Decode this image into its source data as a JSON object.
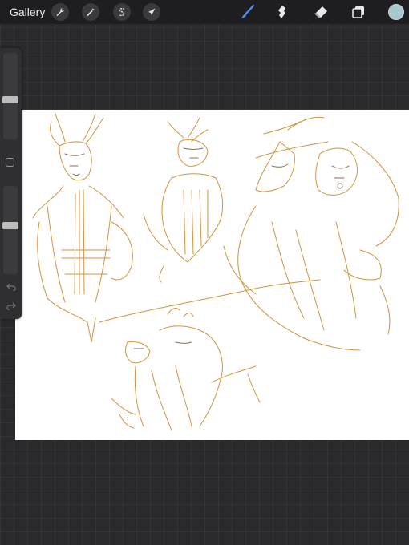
{
  "app": {
    "gallery_label": "Gallery"
  },
  "toolbar": {
    "left_tools": [
      {
        "name": "actions",
        "icon": "wrench-icon"
      },
      {
        "name": "adjustments",
        "icon": "magic-wand-icon"
      },
      {
        "name": "selection",
        "icon": "selection-s-icon"
      },
      {
        "name": "transform",
        "icon": "arrow-cursor-icon"
      }
    ],
    "right_tools": [
      {
        "name": "brush",
        "icon": "brush-icon",
        "active": true,
        "active_color": "#4a8ef0"
      },
      {
        "name": "smudge",
        "icon": "smudge-icon"
      },
      {
        "name": "eraser",
        "icon": "eraser-icon"
      },
      {
        "name": "layers",
        "icon": "layers-icon"
      }
    ],
    "current_color": "#a9c6cf"
  },
  "sidebar": {
    "brush_size_level": 0.45,
    "opacity_level": 0.55
  },
  "canvas": {
    "background": "#ffffff",
    "sketch_color": "#c98a2a",
    "line_color": "#6e5a3a"
  }
}
